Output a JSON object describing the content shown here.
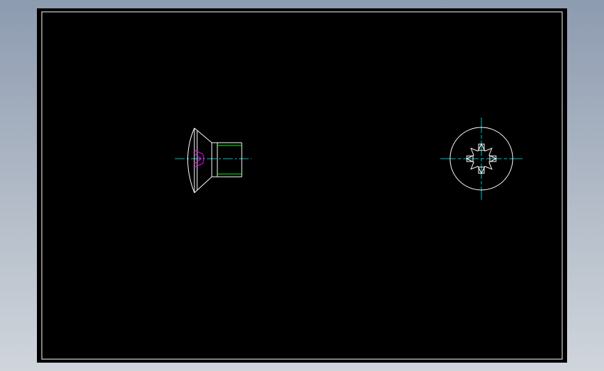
{
  "colors": {
    "background": "#000000",
    "sheet_border": "#ffffff",
    "outline": "#ffffff",
    "centerline": "#00c0c0",
    "thread": "#00ff00",
    "recess": "#ff00ff"
  },
  "views": {
    "side": {
      "label": ""
    },
    "top": {
      "label": ""
    }
  }
}
